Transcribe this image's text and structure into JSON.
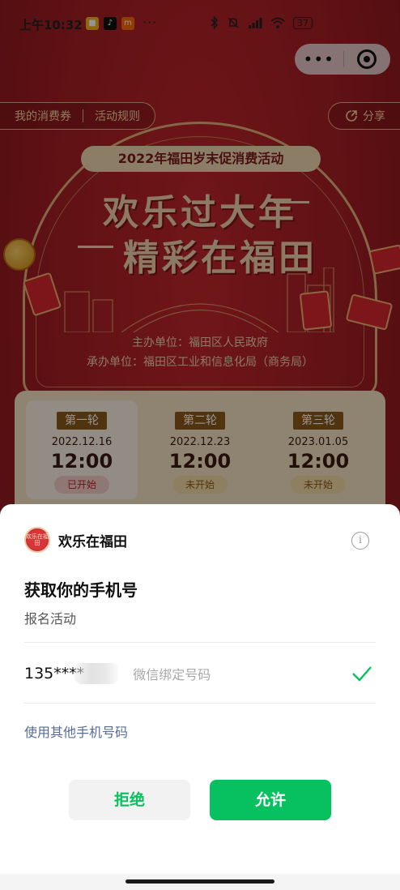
{
  "status_bar": {
    "time": "上午10:32",
    "more": "···",
    "battery": "37"
  },
  "capsule": {
    "more": "•••"
  },
  "topbar": {
    "my_coupons": "我的消费券",
    "rules": "活动规则",
    "share": "分享"
  },
  "banner": {
    "tag": "2022年福田岁末促消费活动",
    "headline_1": "欢乐过大年",
    "headline_2": "精彩在福田",
    "organizer": "主办单位：福田区人民政府",
    "co_organizer": "承办单位：福田区工业和信息化局（商务局）"
  },
  "rounds": [
    {
      "label": "第一轮",
      "date": "2022.12.16",
      "time": "12:00",
      "status": "已开始"
    },
    {
      "label": "第二轮",
      "date": "2022.12.23",
      "time": "12:00",
      "status": "未开始"
    },
    {
      "label": "第三轮",
      "date": "2023.01.05",
      "time": "12:00",
      "status": "未开始"
    }
  ],
  "sheet": {
    "mini_program_name": "欢乐在福田",
    "logo_text": "欢乐在福田",
    "info_icon_glyph": "i",
    "title": "获取你的手机号",
    "subtitle": "报名活动",
    "phone_masked": "135****",
    "phone_note": "微信绑定号码",
    "other_phone_link": "使用其他手机号码",
    "reject_label": "拒绝",
    "allow_label": "允许"
  },
  "colors": {
    "wechat_green": "#07c160",
    "link_blue": "#576b95",
    "page_red": "#c2272d",
    "gold": "#f3d3ae"
  },
  "icons": [
    "share-icon",
    "info-icon",
    "check-icon",
    "close-capsule-icon",
    "more-dots-icon"
  ]
}
